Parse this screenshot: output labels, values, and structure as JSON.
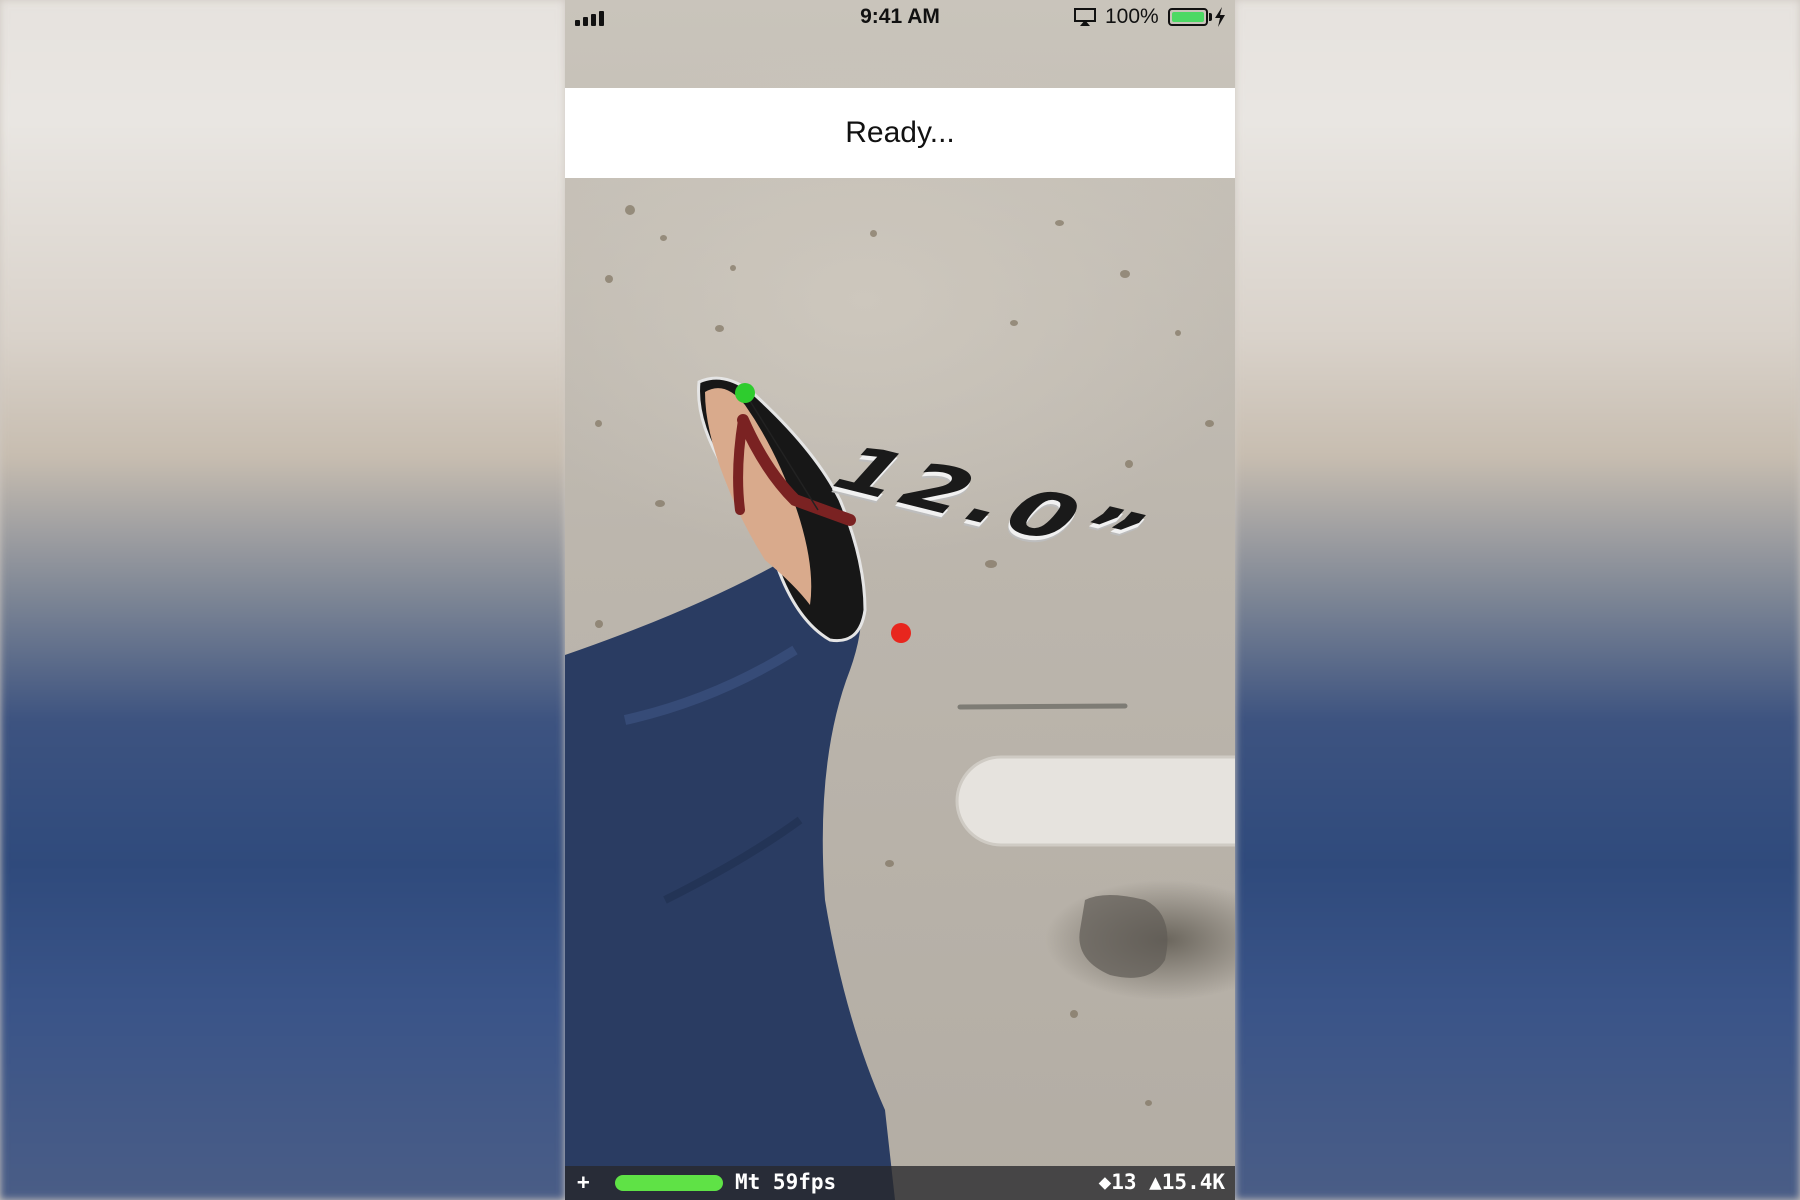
{
  "status_bar": {
    "time": "9:41 AM",
    "battery_percent": "100%",
    "battery_level": 1.0,
    "icons": [
      "signal-icon",
      "airplay-icon",
      "battery-icon",
      "charging-bolt-icon"
    ]
  },
  "banner": {
    "text": "Ready..."
  },
  "measurement": {
    "label": "12.0”",
    "start_point_color": "#2ecc2e",
    "end_point_color": "#e8261e"
  },
  "stats": {
    "plus": "+",
    "meter_color": "#5fe246",
    "fps": "Mt 59fps",
    "counts": "◆13 ▲15.4K"
  }
}
